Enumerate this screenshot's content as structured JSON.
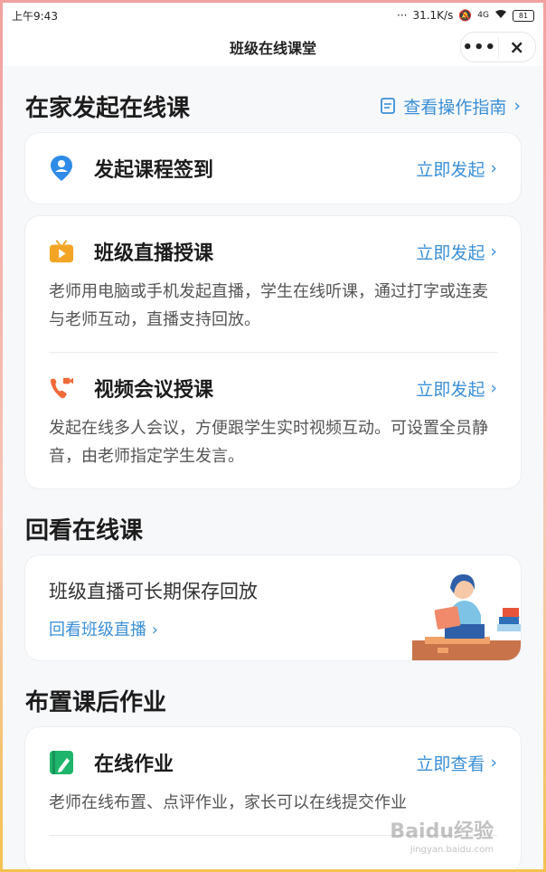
{
  "status": {
    "time": "上午9:43",
    "speed": "31.1K/s",
    "signal": "4G",
    "battery": "81"
  },
  "titlebar": {
    "title": "班级在线课堂",
    "more_icon": "•••",
    "close_icon": "×"
  },
  "section1": {
    "title": "在家发起在线课",
    "guide": "查看操作指南"
  },
  "checkin": {
    "title": "发起课程签到",
    "action": "立即发起"
  },
  "live": {
    "title": "班级直播授课",
    "action": "立即发起",
    "desc": "老师用电脑或手机发起直播，学生在线听课，通过打字或连麦与老师互动，直播支持回放。"
  },
  "meeting": {
    "title": "视频会议授课",
    "action": "立即发起",
    "desc": "发起在线多人会议，方便跟学生实时视频互动。可设置全员静音，由老师指定学生发言。"
  },
  "section2": {
    "title": "回看在线课",
    "card_text": "班级直播可长期保存回放",
    "link": "回看班级直播"
  },
  "section3": {
    "title": "布置课后作业"
  },
  "homework": {
    "title": "在线作业",
    "action": "立即查看",
    "desc": "老师在线布置、点评作业，家长可以在线提交作业"
  },
  "watermark": {
    "brand": "Baidu经验",
    "url": "jingyan.baidu.com"
  },
  "colors": {
    "accent": "#3b8fd6",
    "checkin_icon": "#2f8be6",
    "live_icon": "#f3a526",
    "meeting_icon": "#f06a3a",
    "homework_icon": "#1fb46b"
  }
}
